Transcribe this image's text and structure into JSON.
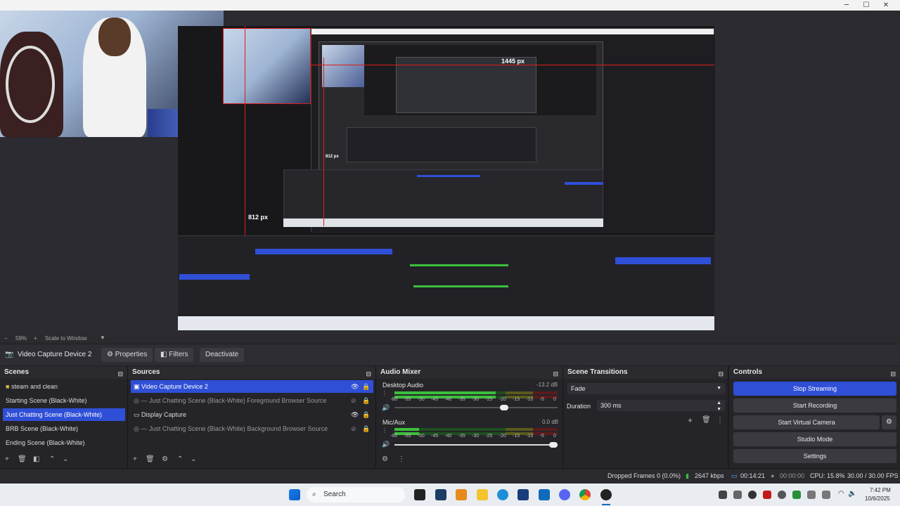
{
  "window": {
    "minimize": "─",
    "maximize": "☐",
    "close": "✕"
  },
  "preview": {
    "width_label": "1445 px",
    "height_label": "812 px",
    "inner_label": "812 px"
  },
  "scalebar": {
    "zoom": "59%",
    "mode": "Scale to Window"
  },
  "context": {
    "source_name": "Video Capture Device 2",
    "properties_label": "Properties",
    "filters_label": "Filters",
    "deactivate_label": "Deactivate"
  },
  "scenes": {
    "title": "Scenes",
    "items": [
      "steam and clean",
      "Starting Scene (Black-White)",
      "Just Chatting Scene (Black-White)",
      "BRB Scene (Black-White)",
      "Ending Scene (Black-White)"
    ],
    "selected_index": 2
  },
  "sources": {
    "title": "Sources",
    "items": [
      "Video Capture Device 2",
      "Just Chatting Scene (Black-White) Foreground Browser Source",
      "Display Capture",
      "Just Chatting Scene (Black-White) Background Browser Source"
    ],
    "selected_index": 0
  },
  "audio_mixer": {
    "title": "Audio Mixer",
    "channels": [
      {
        "name": "Desktop Audio",
        "db": "-13.2 dB",
        "level": 0.62,
        "volume": 0.7
      },
      {
        "name": "Mic/Aux",
        "db": "0.0 dB",
        "level": 0.15,
        "volume": 1.0
      }
    ],
    "scale": [
      "-60",
      "-55",
      "-50",
      "-45",
      "-40",
      "-35",
      "-30",
      "-25",
      "-20",
      "-15",
      "-10",
      "-5",
      "0"
    ]
  },
  "transitions": {
    "title": "Scene Transitions",
    "type": "Fade",
    "duration_label": "Duration",
    "duration_value": "300 ms"
  },
  "controls": {
    "title": "Controls",
    "stop_streaming": "Stop Streaming",
    "start_recording": "Start Recording",
    "start_virtual_camera": "Start Virtual Camera",
    "studio_mode": "Studio Mode",
    "settings": "Settings"
  },
  "status": {
    "dropped_frames": "Dropped Frames 0 (0.0%)",
    "bitrate": "2647 kbps",
    "stream_time": "00:14:21",
    "rec_time": "00:00:00",
    "cpu": "CPU: 15.8%",
    "fps": "30.00 / 30.00 FPS"
  },
  "taskbar": {
    "search": "Search",
    "time": "7:42 PM",
    "date": "10/6/2025"
  },
  "colors": {
    "accent": "#2f4fd6",
    "meter_green": "#3cbf3c",
    "guide_red": "#e01b1b"
  }
}
